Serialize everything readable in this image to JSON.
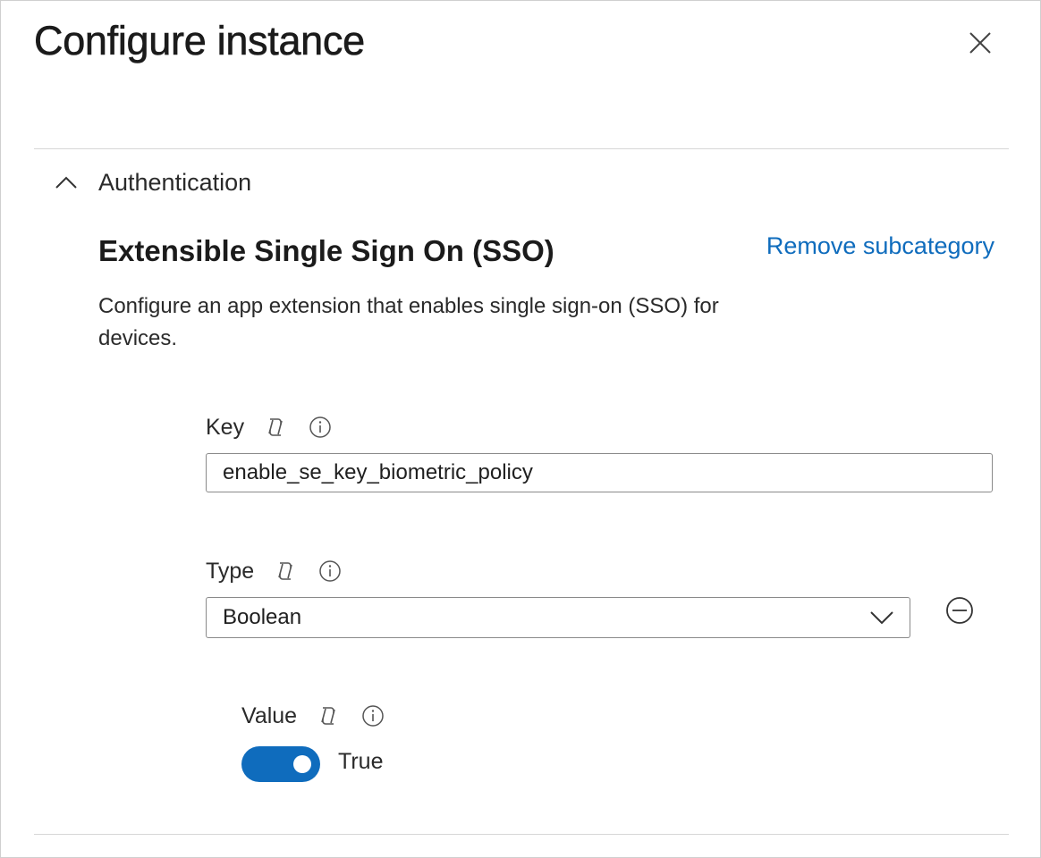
{
  "dialog": {
    "title": "Configure instance",
    "close_icon": "close-icon"
  },
  "section": {
    "title": "Authentication",
    "expanded": true,
    "chevron_icon": "chevron-up-icon"
  },
  "subcategory": {
    "title": "Extensible Single Sign On (SSO)",
    "remove_label": "Remove subcategory",
    "description": "Configure an app extension that enables single sign-on (SSO) for devices."
  },
  "fields": {
    "key": {
      "label": "Key",
      "value": "enable_se_key_biometric_policy",
      "copilot_icon": "copilot-icon",
      "info_icon": "info-icon"
    },
    "type": {
      "label": "Type",
      "selected": "Boolean",
      "copilot_icon": "copilot-icon",
      "info_icon": "info-icon",
      "remove_icon": "minus-circle-icon"
    },
    "value": {
      "label": "Value",
      "toggle_on": true,
      "toggle_text": "True",
      "copilot_icon": "copilot-icon",
      "info_icon": "info-icon"
    }
  },
  "colors": {
    "accent": "#0f6cbd",
    "text": "#1f1f1f",
    "divider": "#d6d6d6",
    "input_border": "#8a8a8a"
  }
}
